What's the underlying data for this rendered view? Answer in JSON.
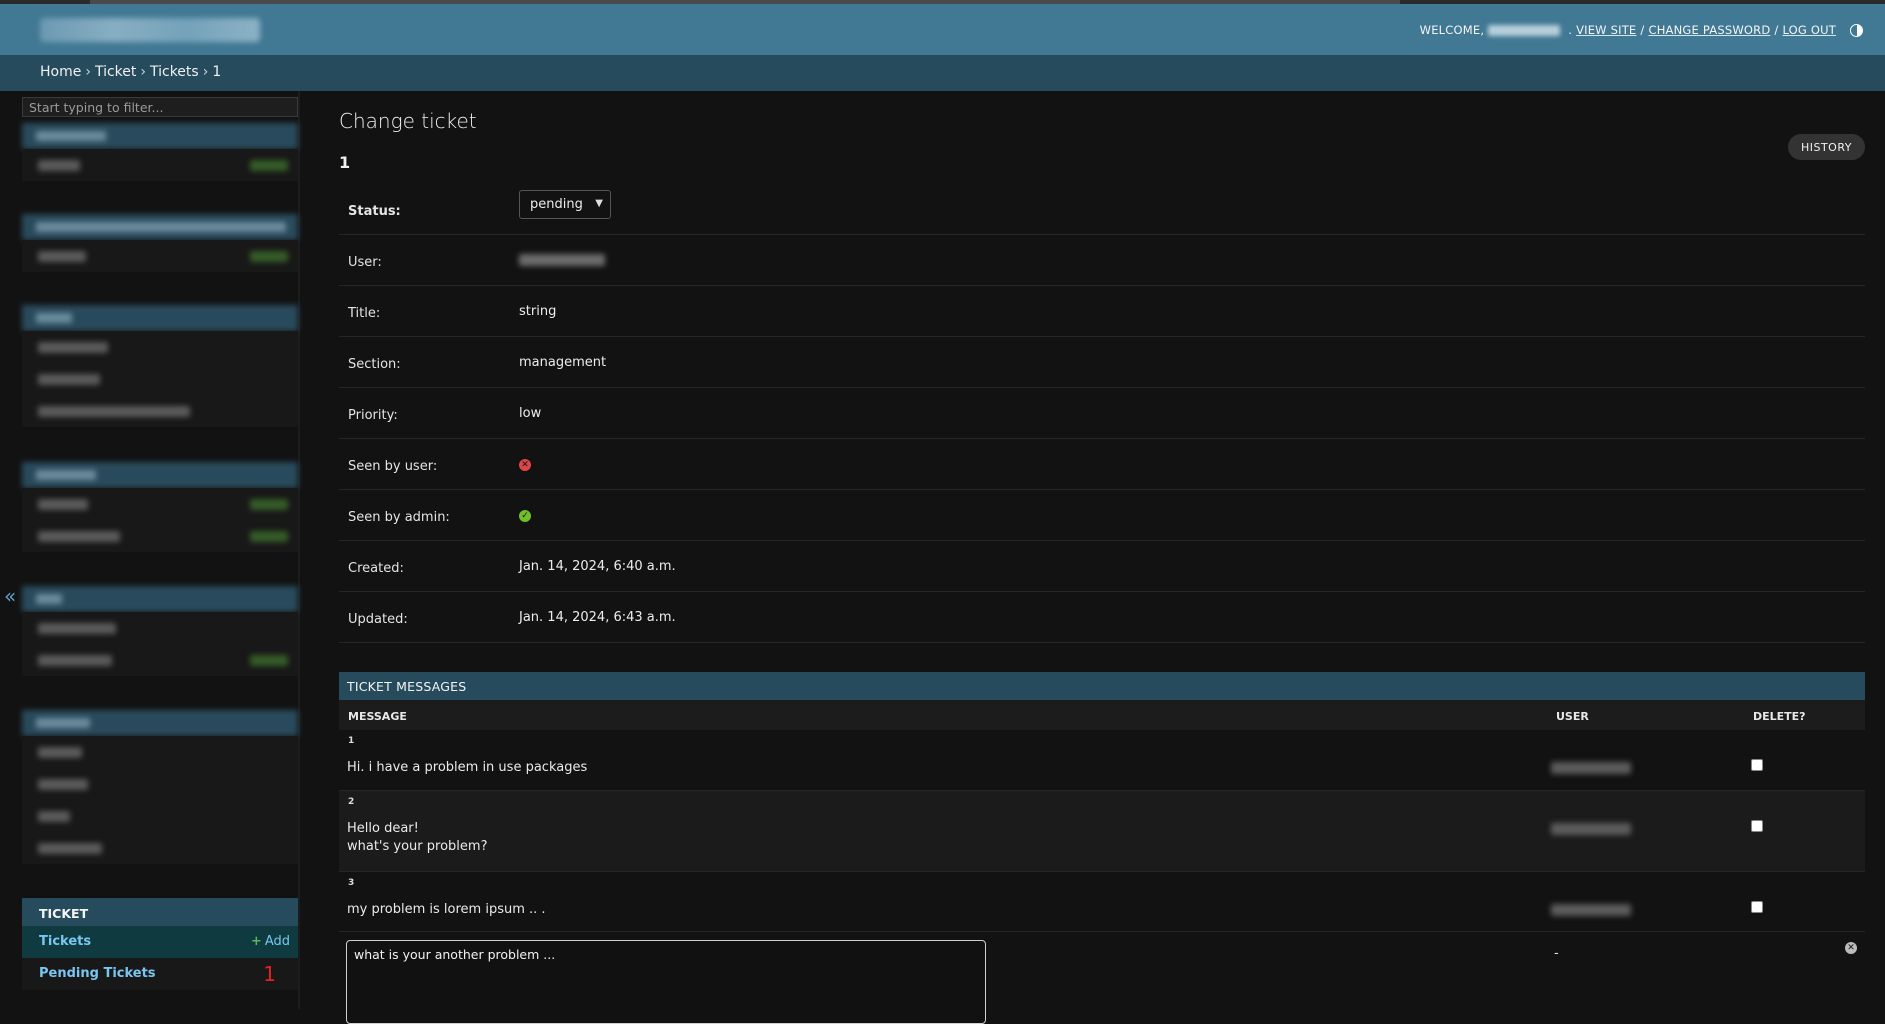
{
  "header": {
    "welcome": "WELCOME,",
    "view_site": "VIEW SITE",
    "change_password": "CHANGE PASSWORD",
    "log_out": "LOG OUT",
    "sep": "/"
  },
  "breadcrumbs": {
    "home": "Home",
    "app": "Ticket",
    "model": "Tickets",
    "object": "1",
    "sep": "›"
  },
  "sidebar": {
    "filter_placeholder": "Start typing to filter...",
    "collapse": "«",
    "ticket_module": {
      "caption": "TICKET",
      "tickets": "Tickets",
      "add_plus": "+",
      "add": "Add",
      "pending": "Pending Tickets",
      "pending_count": "1"
    }
  },
  "content": {
    "title": "Change ticket",
    "object": "1",
    "history": "HISTORY",
    "fields": {
      "status_label": "Status:",
      "status_value": "pending",
      "user_label": "User:",
      "title_label": "Title:",
      "title_value": "string",
      "section_label": "Section:",
      "section_value": "management",
      "priority_label": "Priority:",
      "priority_value": "low",
      "seen_user_label": "Seen by user:",
      "seen_admin_label": "Seen by admin:",
      "created_label": "Created:",
      "created_value": "Jan. 14, 2024, 6:40 a.m.",
      "updated_label": "Updated:",
      "updated_value": "Jan. 14, 2024, 6:43 a.m."
    },
    "inline": {
      "caption": "TICKET MESSAGES",
      "col_message": "MESSAGE",
      "col_user": "USER",
      "col_delete": "DELETE?",
      "rows": [
        {
          "num": "1",
          "message": "Hi. i have a problem in use packages"
        },
        {
          "num": "2",
          "message": "Hello dear!\nwhat's your problem?"
        },
        {
          "num": "3",
          "message": "my problem is lorem ipsum .. ."
        }
      ],
      "new_message": "what is your another problem ...",
      "new_user": "-"
    }
  },
  "colors": {
    "header": "#417893",
    "breadcrumbs": "#264b5d",
    "link": "#79c6f0",
    "badge": "#e02424"
  }
}
